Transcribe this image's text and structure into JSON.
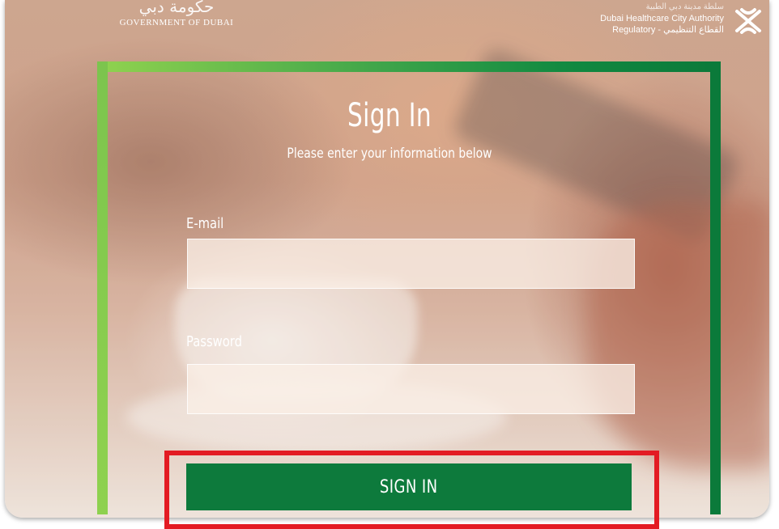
{
  "header": {
    "gov_logo_arabic": "حكومة دبي",
    "gov_logo_english": "GOVERNMENT OF DUBAI",
    "authority_name_arabic": "سلطة مدينة دبي الطبية",
    "authority_name": "Dubai Healthcare City Authority",
    "authority_subtitle": "Regulatory - القطاع التنظيمي",
    "authority_icon": "dhca-star-icon"
  },
  "form": {
    "title": "Sign In",
    "subtitle": "Please enter your information below",
    "email_label": "E-mail",
    "email_value": "",
    "email_placeholder": "",
    "password_label": "Password",
    "password_value": "",
    "password_placeholder": "",
    "submit_label": "SIGN IN"
  },
  "colors": {
    "frame_left": "#8ed14f",
    "frame_right": "#0b7a3a",
    "button": "#0d7a3c",
    "highlight": "#e31b23"
  }
}
